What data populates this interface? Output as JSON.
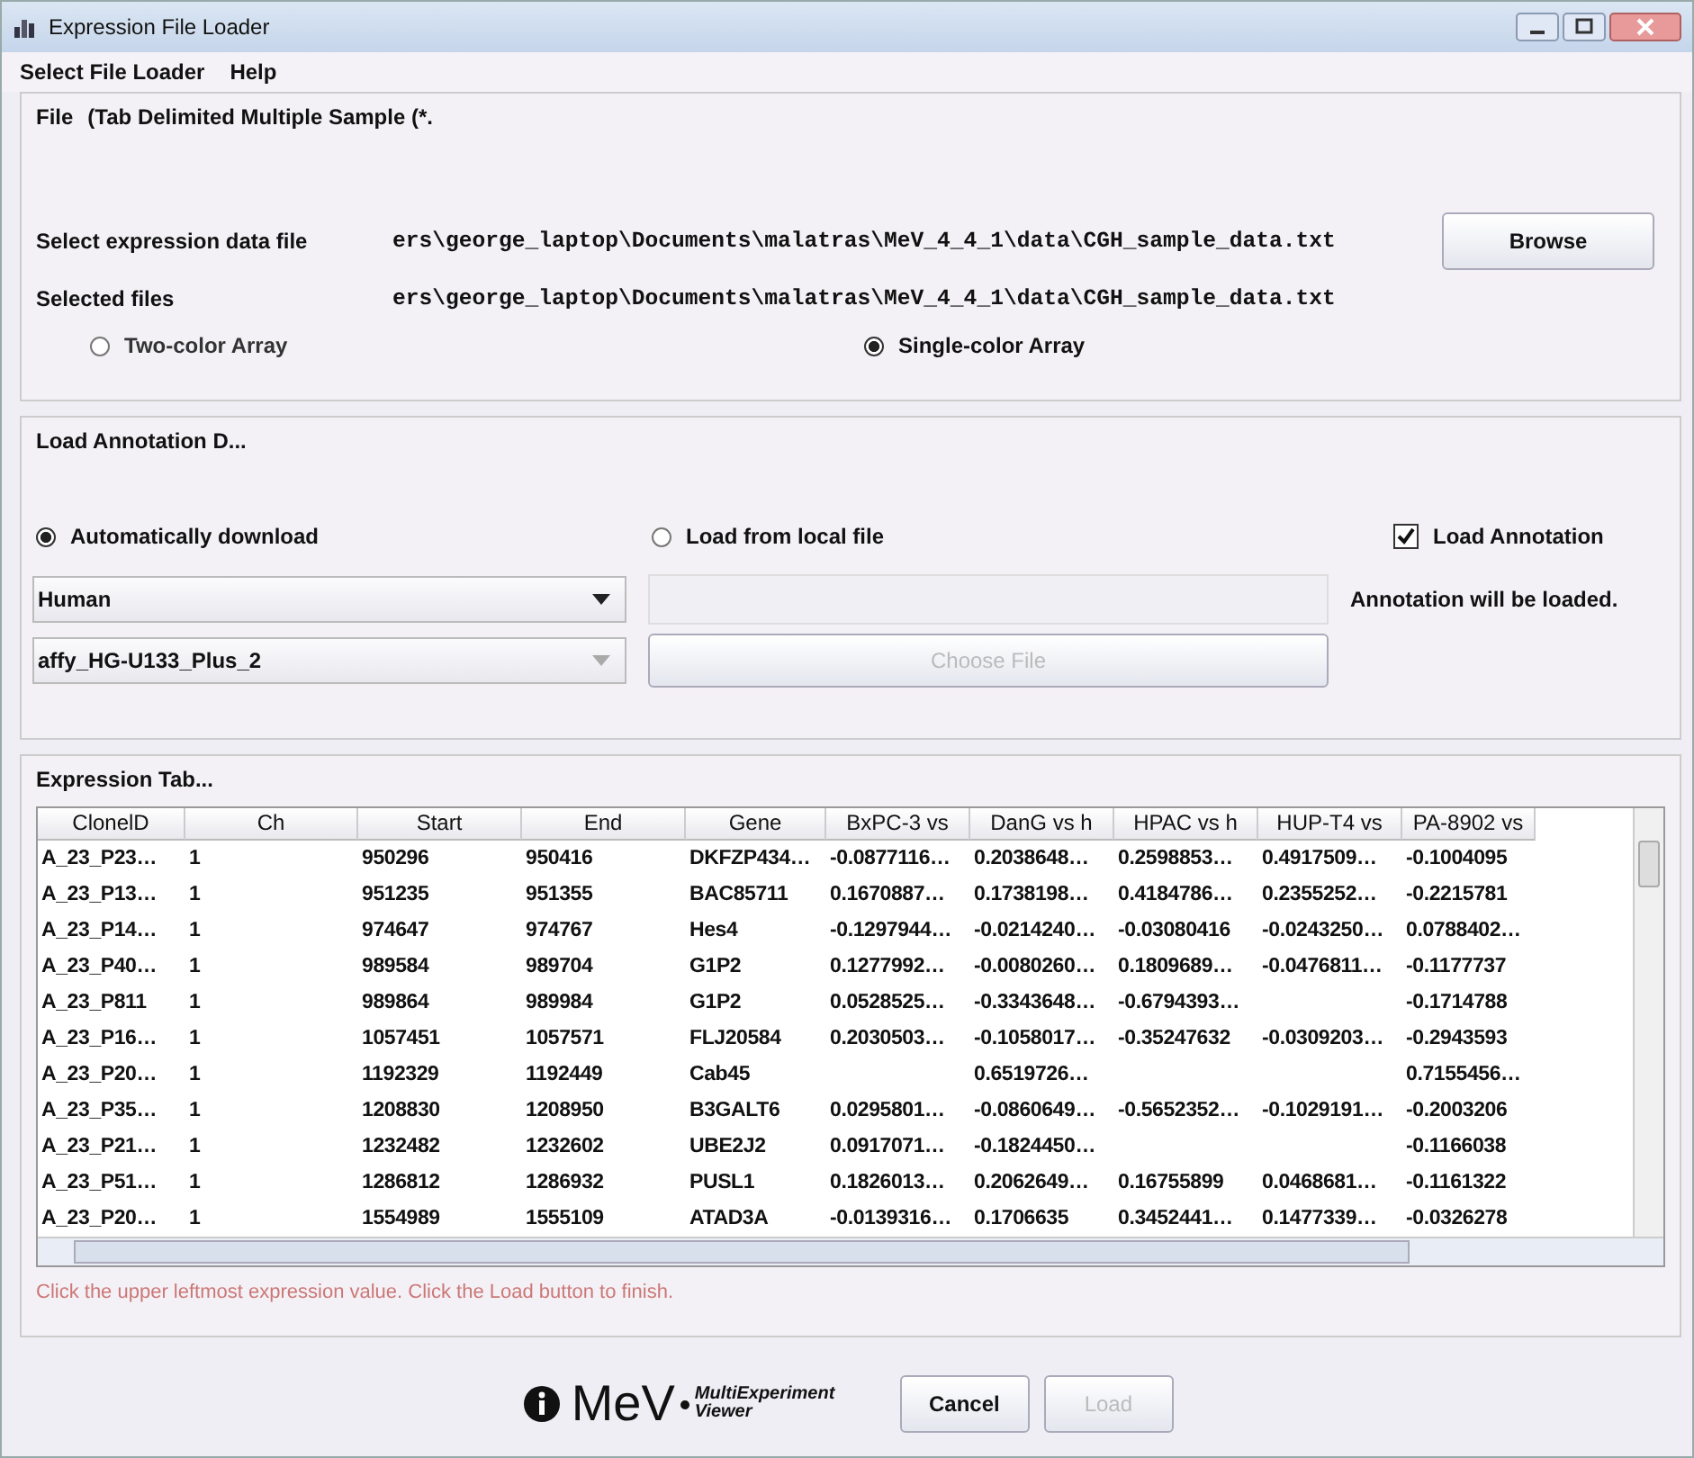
{
  "window": {
    "title": "Expression File Loader"
  },
  "menu": [
    "Select File Loader",
    "Help"
  ],
  "file_panel": {
    "heading": "File",
    "subtitle": "(Tab Delimited Multiple Sample (*.",
    "select_label": "Select expression data file",
    "select_value": "ers\\george_laptop\\Documents\\malatras\\MeV_4_4_1\\data\\CGH_sample_data.txt",
    "browse": "Browse",
    "selected_label": "Selected files",
    "selected_value": "ers\\george_laptop\\Documents\\malatras\\MeV_4_4_1\\data\\CGH_sample_data.txt",
    "array_types": [
      {
        "label": "Two-color Array",
        "selected": false
      },
      {
        "label": "Single-color Array",
        "selected": true
      }
    ]
  },
  "annotation": {
    "heading": "Load Annotation D...",
    "sources": [
      {
        "label": "Automatically download",
        "selected": true
      },
      {
        "label": "Load from local file",
        "selected": false
      }
    ],
    "load_annotation": {
      "label": "Load Annotation",
      "checked": true
    },
    "organism": "Human",
    "array": "affy_HG-U133_Plus_2",
    "choose_file": {
      "label": "Choose File",
      "disabled": true
    },
    "status": "Annotation will be loaded."
  },
  "table": {
    "title": "Expression Tab...",
    "columns": [
      "ClonelD",
      "Ch",
      "Start",
      "End",
      "Gene",
      "BxPC-3 vs",
      "DanG vs h",
      "HPAC vs h",
      "HUP-T4 vs",
      "PA-8902 vs"
    ],
    "rows": [
      [
        "A_23_P23…",
        "1",
        "950296",
        "950416",
        "DKFZP434…",
        "-0.0877116…",
        "0.2038648…",
        "0.2598853…",
        "0.4917509…",
        "-0.1004095"
      ],
      [
        "A_23_P13…",
        "1",
        "951235",
        "951355",
        "BAC85711",
        "0.1670887…",
        "0.1738198…",
        "0.4184786…",
        "0.2355252…",
        "-0.2215781"
      ],
      [
        "A_23_P14…",
        "1",
        "974647",
        "974767",
        "Hes4",
        "-0.1297944…",
        "-0.0214240…",
        "-0.03080416",
        "-0.0243250…",
        "0.0788402…"
      ],
      [
        "A_23_P40…",
        "1",
        "989584",
        "989704",
        "G1P2",
        "0.1277992…",
        "-0.0080260…",
        "0.1809689…",
        "-0.0476811…",
        "-0.1177737"
      ],
      [
        "A_23_P811",
        "1",
        "989864",
        "989984",
        "G1P2",
        "0.0528525…",
        "-0.3343648…",
        "-0.6794393…",
        null,
        "-0.1714788"
      ],
      [
        "A_23_P16…",
        "1",
        "1057451",
        "1057571",
        "FLJ20584",
        "0.2030503…",
        "-0.1058017…",
        "-0.35247632",
        "-0.0309203…",
        "-0.2943593"
      ],
      [
        "A_23_P20…",
        "1",
        "1192329",
        "1192449",
        "Cab45",
        null,
        "0.6519726…",
        null,
        null,
        "0.7155456…"
      ],
      [
        "A_23_P35…",
        "1",
        "1208830",
        "1208950",
        "B3GALT6",
        "0.0295801…",
        "-0.0860649…",
        "-0.5652352…",
        "-0.1029191…",
        "-0.2003206"
      ],
      [
        "A_23_P21…",
        "1",
        "1232482",
        "1232602",
        "UBE2J2",
        "0.0917071…",
        "-0.1824450…",
        null,
        null,
        "-0.1166038"
      ],
      [
        "A_23_P51…",
        "1",
        "1286812",
        "1286932",
        "PUSL1",
        "0.1826013…",
        "0.2062649…",
        "0.16755899",
        "0.0468681…",
        "-0.1161322"
      ],
      [
        "A_23_P20…",
        "1",
        "1554989",
        "1555109",
        "ATAD3A",
        "-0.0139316…",
        "0.1706635",
        "0.3452441…",
        "0.1477339…",
        "-0.0326278"
      ]
    ]
  },
  "hint": "Click the upper leftmost expression value. Click the Load button to finish.",
  "logo": {
    "name": "MeV",
    "line1": "MultiExperiment",
    "line2": "Viewer"
  },
  "buttons": [
    {
      "label": "Cancel",
      "disabled": false
    },
    {
      "label": "Load",
      "disabled": true
    }
  ]
}
